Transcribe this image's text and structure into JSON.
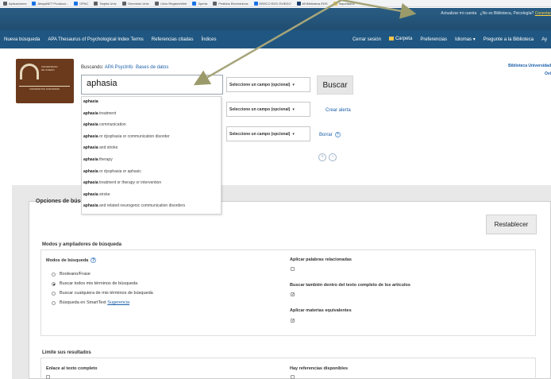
{
  "bookmarks": [
    {
      "label": "Aplicaciones",
      "color": "#5f6368"
    },
    {
      "label": "AbsysNET Producci...",
      "color": "#1a73e8"
    },
    {
      "label": "OPAC",
      "color": "#1a73e8"
    },
    {
      "label": "Tarjeta Univ.",
      "color": "#5f6368"
    },
    {
      "label": "Directorio Univ.",
      "color": "#5f6368"
    },
    {
      "label": "Libro RegistroWeb",
      "color": "#5f6368"
    },
    {
      "label": "Xperta",
      "color": "#1a73e8"
    },
    {
      "label": "Pedidos Electrónicos",
      "color": "#5f6368"
    },
    {
      "label": "EBSCO EDS OVIEDO",
      "color": "#1a73e8"
    },
    {
      "label": "Mi Biblioteca EDS",
      "color": "#1a3e6e"
    },
    {
      "label": "Importados",
      "color": "#f3c54a"
    }
  ],
  "topbar": {
    "update_account": "Actualizar mi cuenta",
    "not_user": "¿No es Biblioteca, Psicología?",
    "connect": "Conectar"
  },
  "nav": {
    "left": [
      "Nueva búsqueda",
      "APA Thesaurus of Psychological Index Terms",
      "Referencias citadas",
      "Índices"
    ],
    "logout": "Cerrar sesión",
    "folder": "Carpeta",
    "prefs": "Preferencias",
    "languages": "Idiomas",
    "ask": "Pregunte a la Biblioteca",
    "more": "Ay"
  },
  "logo": {
    "line1": "UNIVERSIDAD",
    "line2": "DE OVIEDO",
    "line3": "UNIVERSITAS OVETENSIS"
  },
  "search": {
    "prefix": "Buscando:",
    "db": "APA PsycInfo",
    "databases": "Bases de datos",
    "value": "aphasia",
    "field_select": "Seleccione un campo (opcional)",
    "search_button": "Buscar",
    "create_alert": "Crear alerta",
    "clear": "Borrar",
    "add_row": "+",
    "remove_row": "−"
  },
  "institution": {
    "line1": "Biblioteca Universidad",
    "line2": "Ovi"
  },
  "suggestions": [
    {
      "bold": "aphasia",
      "rest": ""
    },
    {
      "bold": "aphasia",
      "rest": " treatment"
    },
    {
      "bold": "aphasia",
      "rest": " communication"
    },
    {
      "bold": "aphasia",
      "rest": " or dysphasia or communication disorder"
    },
    {
      "bold": "aphasia",
      "rest": " and stroke"
    },
    {
      "bold": "aphasia",
      "rest": " therapy"
    },
    {
      "bold": "aphasia",
      "rest": " or dysphasia or aphasic"
    },
    {
      "bold": "aphasia",
      "rest": " treatment or therapy or intervention"
    },
    {
      "bold": "aphasia",
      "rest": " stroke"
    },
    {
      "bold": "aphasia",
      "rest": " and related neurogenic communication disorders"
    }
  ],
  "options": {
    "title": "Opciones de búsc",
    "reset": "Restablecer",
    "modes_section": "Modos y ampliadores de búsqueda",
    "modes_label": "Modos de búsqueda",
    "modes": [
      "Booleano/Frase",
      "Buscar todos mis términos de búsqueda",
      "Buscar cualquiera de mis términos de búsqueda",
      "Búsqueda en SmartText"
    ],
    "suggestion_link": "Sugerencia",
    "related_words": "Aplicar palabras relacionadas",
    "fulltext_search": "Buscar también dentro del texto completo de los artículos",
    "equiv_subjects": "Aplicar materias equivalentes",
    "limits_section": "Limite sus resultados",
    "full_text_link": "Enlace al texto completo",
    "has_refs": "Hay referencias disponibles"
  }
}
